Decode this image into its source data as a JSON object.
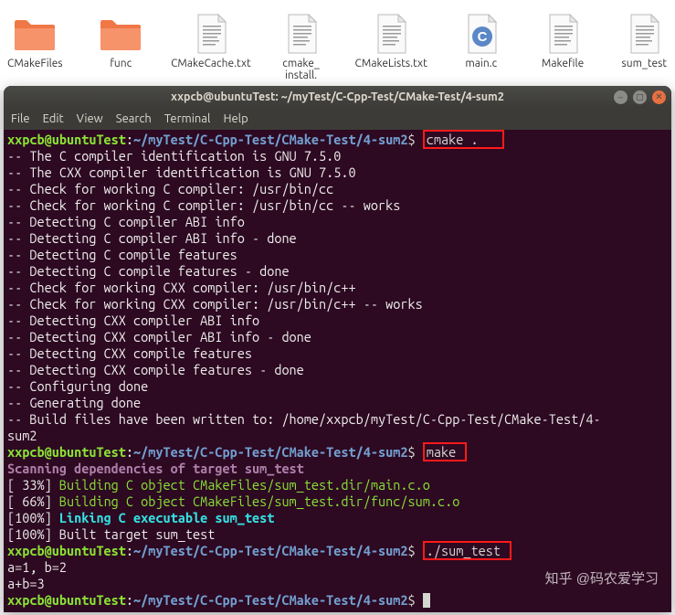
{
  "desktop": {
    "items": [
      {
        "label": "CMakeFiles",
        "type": "folder"
      },
      {
        "label": "func",
        "type": "folder"
      },
      {
        "label": "CMakeCache.txt",
        "type": "doc"
      },
      {
        "label": "cmake_\ninstall.",
        "type": "doc"
      },
      {
        "label": "CMakeLists.txt",
        "type": "doc"
      },
      {
        "label": "main.c",
        "type": "c"
      },
      {
        "label": "Makefile",
        "type": "doc"
      },
      {
        "label": "sum_test",
        "type": "doc"
      }
    ]
  },
  "window": {
    "title": "xxpcb@ubuntuTest: ~/myTest/C-Cpp-Test/CMake-Test/4-sum2",
    "menu": [
      "File",
      "Edit",
      "View",
      "Search",
      "Terminal",
      "Help"
    ]
  },
  "prompt": {
    "user": "xxpcb@ubuntuTest",
    "colon": ":",
    "path": "~/myTest/C-Cpp-Test/CMake-Test/4-sum2",
    "dollar": "$"
  },
  "commands": {
    "cmake": "cmake .",
    "make": "make",
    "run": "./sum_test"
  },
  "output": {
    "cmake": [
      "-- The C compiler identification is GNU 7.5.0",
      "-- The CXX compiler identification is GNU 7.5.0",
      "-- Check for working C compiler: /usr/bin/cc",
      "-- Check for working C compiler: /usr/bin/cc -- works",
      "-- Detecting C compiler ABI info",
      "-- Detecting C compiler ABI info - done",
      "-- Detecting C compile features",
      "-- Detecting C compile features - done",
      "-- Check for working CXX compiler: /usr/bin/c++",
      "-- Check for working CXX compiler: /usr/bin/c++ -- works",
      "-- Detecting CXX compiler ABI info",
      "-- Detecting CXX compiler ABI info - done",
      "-- Detecting CXX compile features",
      "-- Detecting CXX compile features - done",
      "-- Configuring done",
      "-- Generating done",
      "-- Build files have been written to: /home/xxpcb/myTest/C-Cpp-Test/CMake-Test/4-",
      "sum2"
    ],
    "make_scan": "Scanning dependencies of target sum_test",
    "make_p33": "[ 33%] ",
    "make_b1": "Building C object CMakeFiles/sum_test.dir/main.c.o",
    "make_p66": "[ 66%] ",
    "make_b2": "Building C object CMakeFiles/sum_test.dir/func/sum.c.o",
    "make_p100a": "[100%] ",
    "make_link": "Linking C executable sum_test",
    "make_p100b": "[100%] Built target sum_test",
    "run1": "a=1, b=2",
    "run2": "a+b=3"
  },
  "watermark": "知乎 @码农爱学习"
}
